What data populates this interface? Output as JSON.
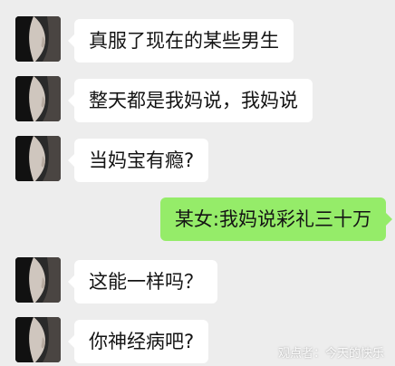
{
  "messages": [
    {
      "side": "in",
      "text": "真服了现在的某些男生",
      "avatar": "contact-avatar"
    },
    {
      "side": "in",
      "text": "整天都是我妈说，我妈说",
      "avatar": "contact-avatar"
    },
    {
      "side": "in",
      "text": "当妈宝有瘾?",
      "avatar": "contact-avatar"
    },
    {
      "side": "out",
      "text": "某女:我妈说彩礼三十万"
    },
    {
      "side": "in",
      "text": "这能一样吗？",
      "avatar": "contact-avatar"
    },
    {
      "side": "in",
      "text": "你神经病吧?",
      "avatar": "contact-avatar"
    }
  ],
  "watermark": "观点者：今天的快乐",
  "colors": {
    "background": "#ededed",
    "incoming_bubble": "#ffffff",
    "outgoing_bubble": "#95ec69"
  }
}
